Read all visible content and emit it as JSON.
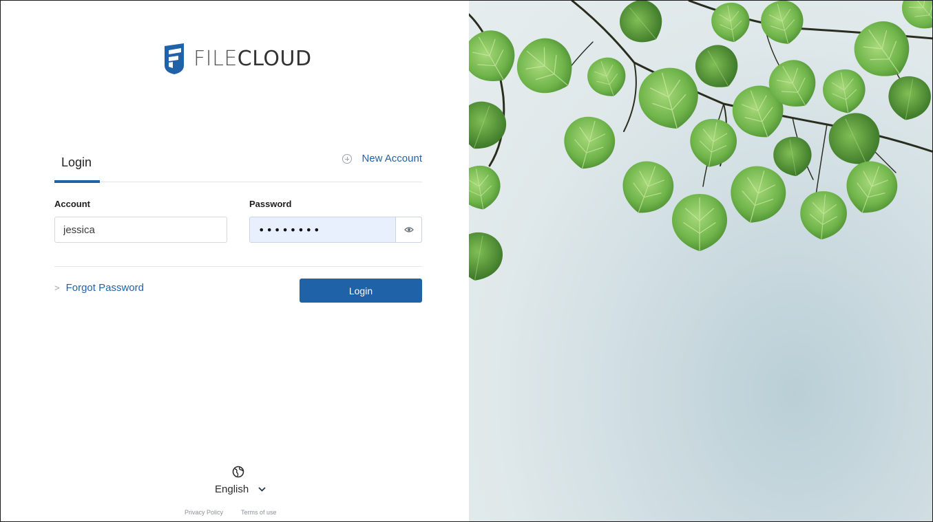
{
  "brand": {
    "name_part1": "FILE",
    "name_part2": "CLOUD",
    "logo_icon": "filecloud-logo-icon",
    "accent": "#1f62a8"
  },
  "tabs": {
    "login": "Login",
    "new_account": "New Account"
  },
  "form": {
    "account_label": "Account",
    "account_value": "jessica",
    "password_label": "Password",
    "password_value": "••••••••",
    "forgot_password": "Forgot Password",
    "login_button": "Login"
  },
  "language": {
    "selected": "English"
  },
  "footer": {
    "privacy": "Privacy Policy",
    "terms": "Terms of use"
  },
  "colors": {
    "primary": "#1f62a8",
    "password_bg": "#e8f0fe"
  }
}
